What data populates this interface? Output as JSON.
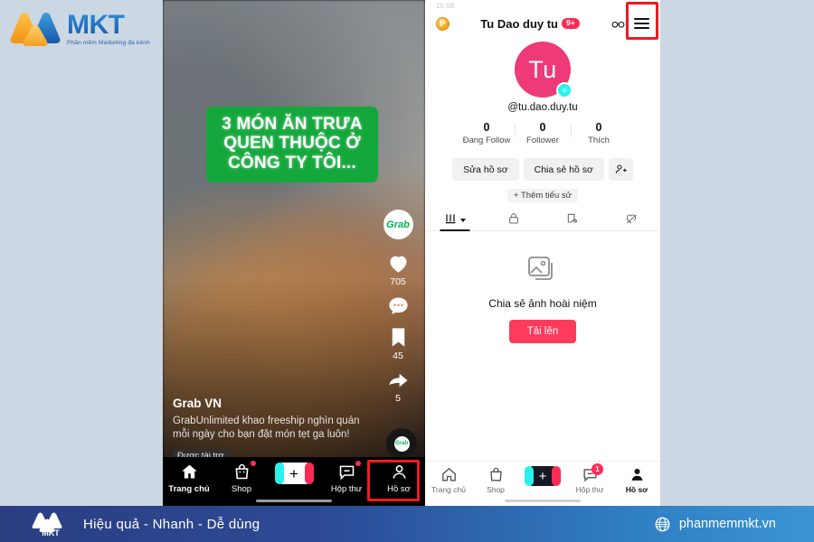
{
  "brand": {
    "name": "MKT",
    "tagline": "Phần mềm Marketing đa kênh"
  },
  "feed": {
    "overlay_title": "3 MÓN ĂN TRƯA QUEN THUỘC Ở CÔNG TY TÔI...",
    "overlay_lines": [
      "3 MÓN ĂN TRƯA",
      "QUEN THUỘC Ở",
      "CÔNG TY TÔI..."
    ],
    "brand_avatar_label": "Grab",
    "actions": {
      "like_count": "705",
      "comment_count": "",
      "bookmark_count": "45",
      "share_count": "5"
    },
    "music_disc_label": "Grab",
    "caption": {
      "author": "Grab VN",
      "text": "GrabUnlimited khao freeship nghìn quán mỗi ngày cho bạn đặt món tẹt ga luôn!",
      "sponsored_badge": "Được tài trợ"
    },
    "nav": [
      {
        "label": "Trang chủ",
        "icon": "home-icon",
        "active": true
      },
      {
        "label": "Shop",
        "icon": "shop-bag-icon",
        "active": false
      },
      {
        "label": "",
        "icon": "create-plus-icon",
        "active": false
      },
      {
        "label": "Hộp thư",
        "icon": "inbox-message-icon",
        "active": false
      },
      {
        "label": "Hồ sơ",
        "icon": "profile-person-icon",
        "active": false
      }
    ]
  },
  "profile": {
    "status_bar": {
      "time": "10:08",
      "right": ""
    },
    "header": {
      "coin_label": "P",
      "title": "Tu Dao duy tu",
      "title_badge": "9+",
      "friends_icon": "friends-glasses-icon",
      "menu_icon": "hamburger-menu-icon"
    },
    "avatar": {
      "initials": "Tu",
      "plus": "+",
      "color": "#ee3a78"
    },
    "handle": "@tu.dao.duy.tu",
    "stats": [
      {
        "value": "0",
        "label": "Đang Follow"
      },
      {
        "value": "0",
        "label": "Follower"
      },
      {
        "value": "0",
        "label": "Thích"
      }
    ],
    "actions": {
      "edit_profile": "Sửa hồ sơ",
      "share_profile": "Chia sẻ hồ sơ",
      "add_friend_icon": "add-person-icon",
      "add_bio": "+ Thêm tiểu sử"
    },
    "tabs": [
      {
        "icon": "grid-posts-icon",
        "active": true,
        "has_caret": true
      },
      {
        "icon": "lock-private-icon",
        "active": false,
        "has_caret": false
      },
      {
        "icon": "repost-icon",
        "active": false,
        "has_caret": false
      },
      {
        "icon": "liked-hidden-heart-icon",
        "active": false,
        "has_caret": false
      }
    ],
    "empty_state": {
      "icon": "photo-stack-icon",
      "text": "Chia sẻ ảnh hoài niệm",
      "button": "Tải lên"
    },
    "nav": [
      {
        "label": "Trang chủ",
        "icon": "home-icon",
        "active": false,
        "badge": ""
      },
      {
        "label": "Shop",
        "icon": "shop-bag-icon",
        "active": false,
        "badge": ""
      },
      {
        "label": "",
        "icon": "create-plus-icon",
        "active": false,
        "badge": ""
      },
      {
        "label": "Hộp thư",
        "icon": "inbox-message-icon",
        "active": false,
        "badge": "1"
      },
      {
        "label": "Hồ sơ",
        "icon": "profile-person-icon",
        "active": true,
        "badge": ""
      }
    ]
  },
  "footer": {
    "logo": "MKT",
    "slogan": "Hiệu quả - Nhanh - Dễ dùng",
    "website": "phanmemmkt.vn",
    "globe_icon": "globe-icon"
  },
  "annotations": {
    "highlight_color": "#ee1b23",
    "boxes": [
      "profile-tab-highlight",
      "hamburger-menu-highlight"
    ]
  }
}
